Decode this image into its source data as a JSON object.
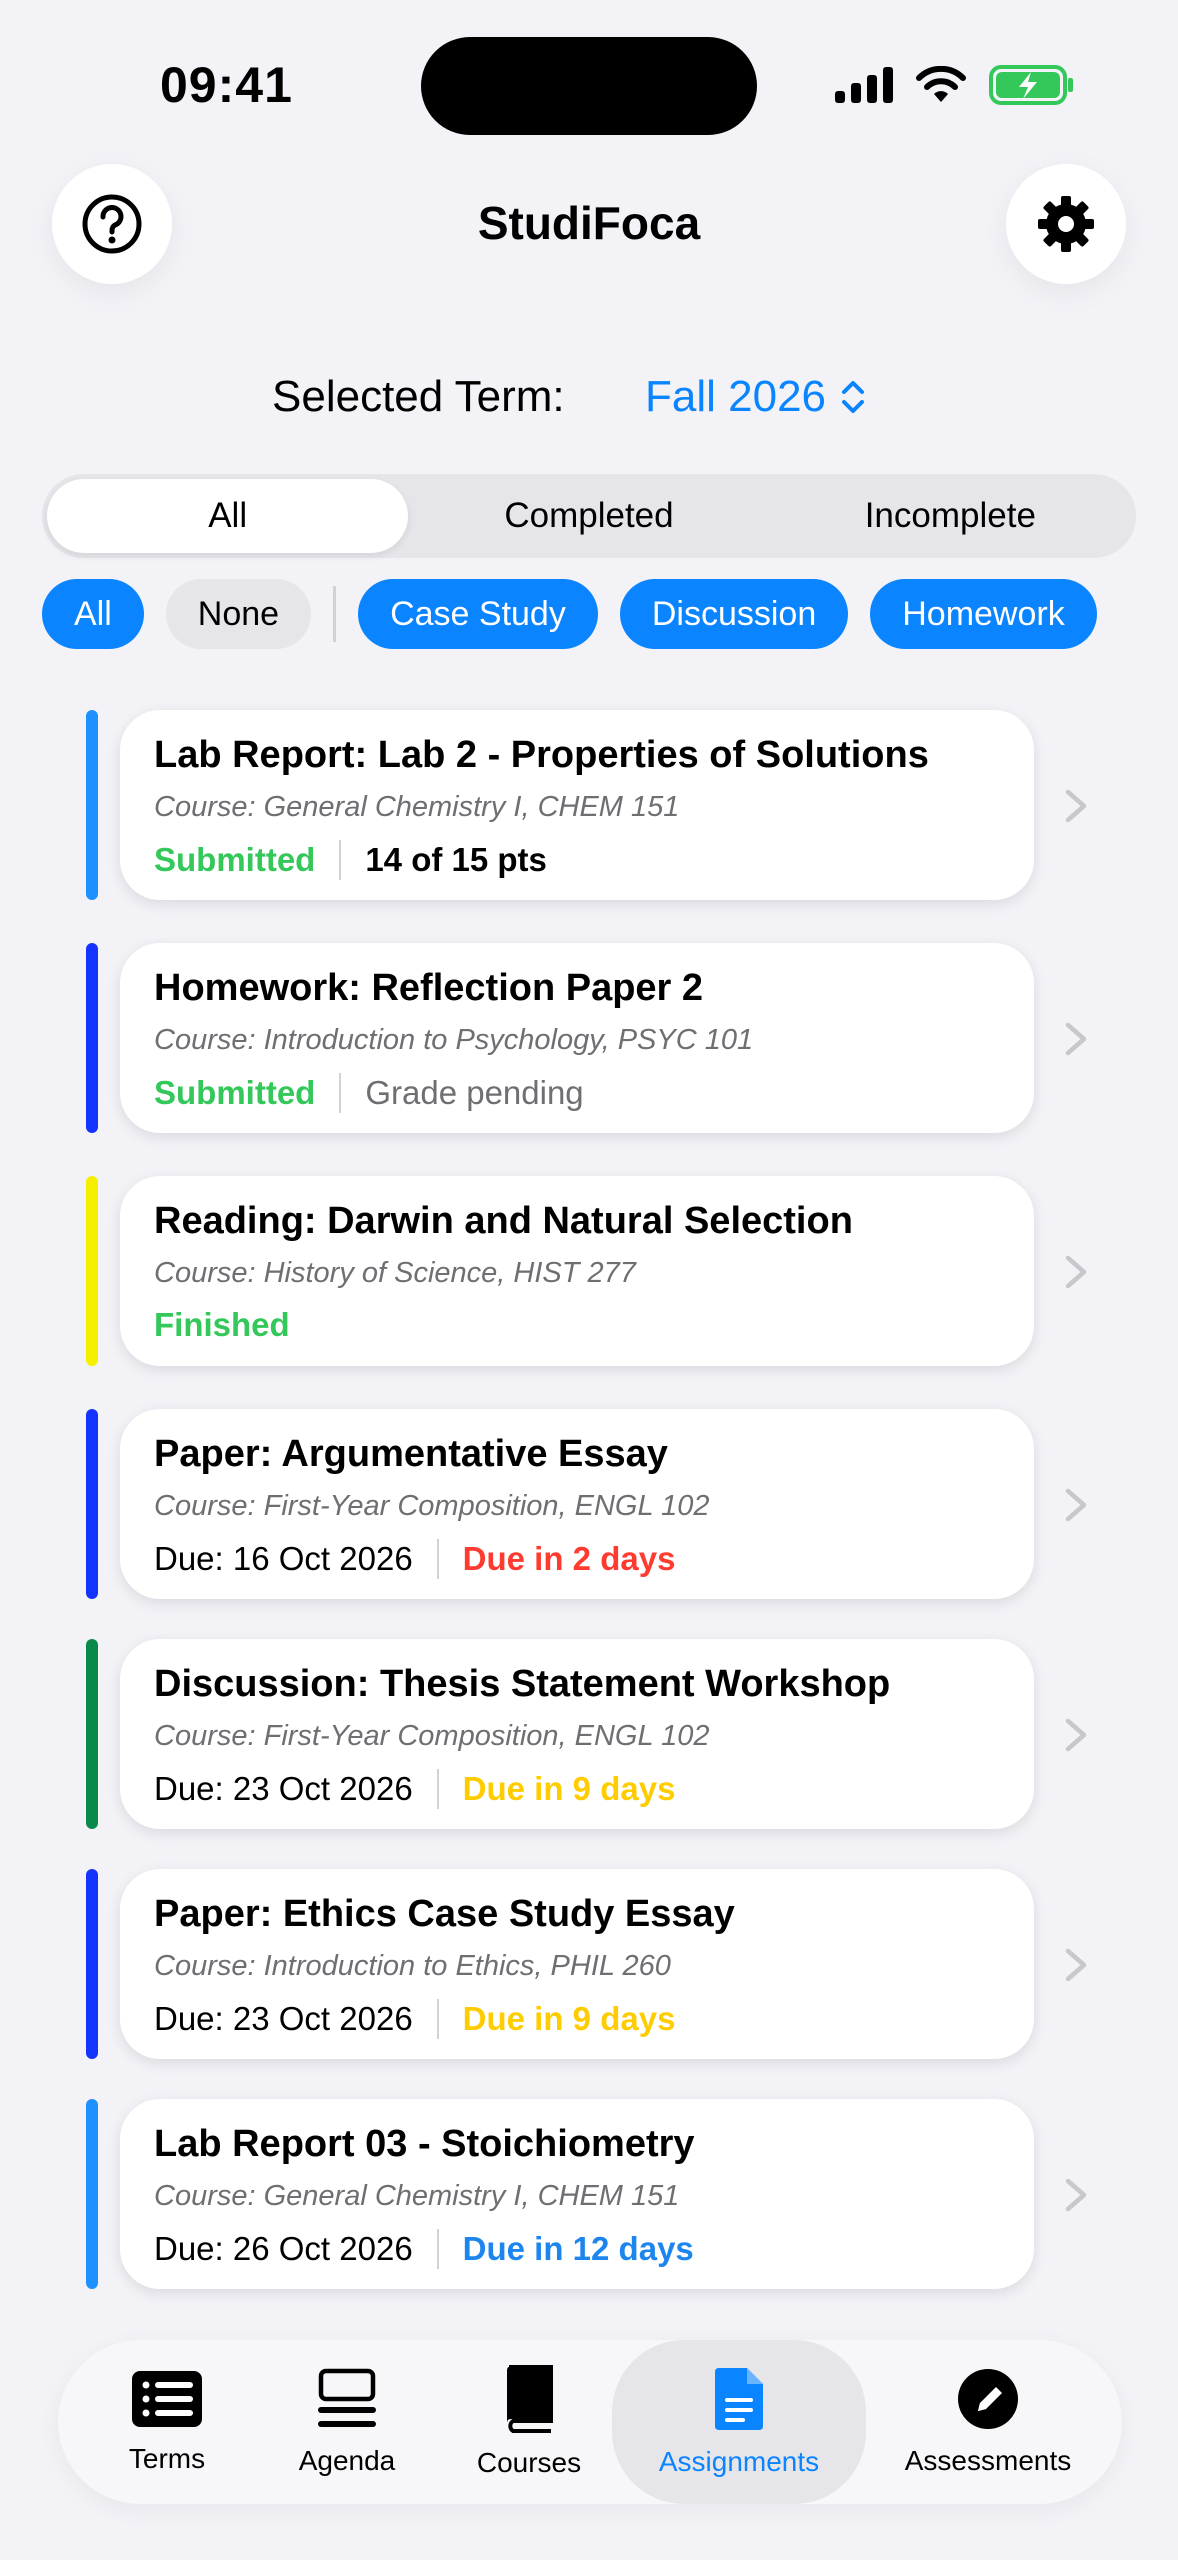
{
  "status_bar": {
    "time": "09:41"
  },
  "header": {
    "title": "StudiFoca"
  },
  "term": {
    "label": "Selected Term:",
    "value": "Fall 2026"
  },
  "segments": [
    {
      "label": "All",
      "active": true
    },
    {
      "label": "Completed",
      "active": false
    },
    {
      "label": "Incomplete",
      "active": false
    }
  ],
  "chips": {
    "all": "All",
    "none": "None",
    "types": [
      "Case Study",
      "Discussion",
      "Homework"
    ]
  },
  "colors": {
    "accent": "#0a84ff",
    "green": "#34c759",
    "red": "#ff3b30",
    "yellow": "#ffcc00",
    "blue_text": "#1c86ee"
  },
  "assignments": [
    {
      "title": "Lab Report: Lab 2 - Properties of Solutions",
      "course": "Course: General Chemistry I, CHEM 151",
      "meta_a": "Submitted",
      "meta_b": "14 of 15 pts",
      "stripe": "#1e90ff"
    },
    {
      "title": "Homework: Reflection Paper 2",
      "course": "Course: Introduction to Psychology, PSYC 101",
      "meta_a": "Submitted",
      "meta_b": "Grade pending",
      "stripe": "#1433ff"
    },
    {
      "title": "Reading: Darwin and Natural Selection",
      "course": "Course: History of Science, HIST 277",
      "meta_a": "Finished",
      "meta_b": "",
      "stripe": "#f5f000"
    },
    {
      "title": "Paper: Argumentative Essay",
      "course": "Course: First-Year Composition, ENGL 102",
      "meta_a": "Due: 16 Oct 2026",
      "meta_b": "Due in 2 days",
      "stripe": "#1433ff"
    },
    {
      "title": "Discussion: Thesis Statement Workshop",
      "course": "Course: First-Year Composition, ENGL 102",
      "meta_a": "Due: 23 Oct 2026",
      "meta_b": "Due in 9 days",
      "stripe": "#0a8a4a"
    },
    {
      "title": "Paper: Ethics Case Study Essay",
      "course": "Course: Introduction to Ethics, PHIL 260",
      "meta_a": "Due: 23 Oct 2026",
      "meta_b": "Due in 9 days",
      "stripe": "#1433ff"
    },
    {
      "title": "Lab Report 03 - Stoichiometry",
      "course": "Course: General Chemistry I, CHEM 151",
      "meta_a": "Due: 26 Oct 2026",
      "meta_b": "Due in 12 days",
      "stripe": "#1e90ff"
    }
  ],
  "tabbar": [
    {
      "label": "Terms",
      "icon": "list-icon"
    },
    {
      "label": "Agenda",
      "icon": "agenda-icon"
    },
    {
      "label": "Courses",
      "icon": "book-icon"
    },
    {
      "label": "Assignments",
      "icon": "document-icon",
      "active": true
    },
    {
      "label": "Assessments",
      "icon": "pencil-circle-icon"
    }
  ]
}
